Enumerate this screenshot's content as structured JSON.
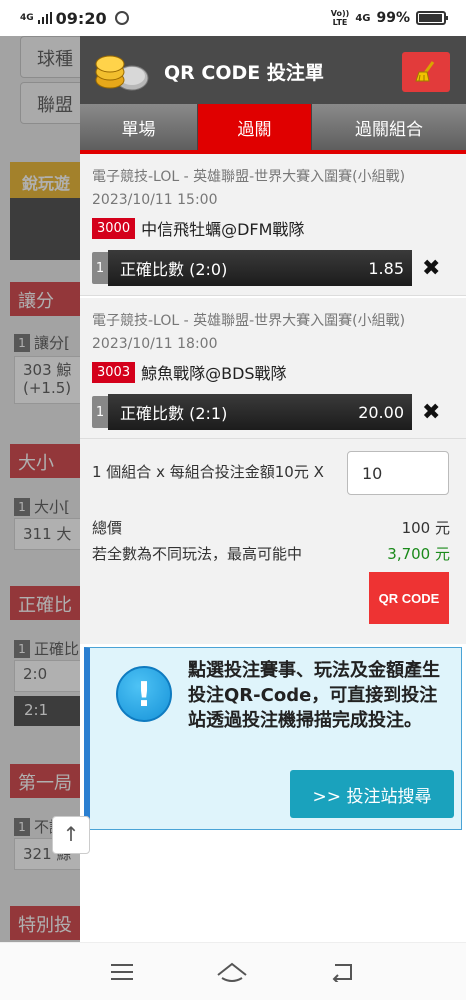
{
  "status_bar": {
    "signal": "4G",
    "time": "09:20",
    "network_top": "Vo))",
    "network_mid": "LTE",
    "network_4g": "4G",
    "battery": "99%"
  },
  "background": {
    "buttons": [
      "球種",
      "聯盟"
    ],
    "gold_tab": "銳玩遊",
    "section_1": "讓分",
    "row_1": "讓分[",
    "card_1_line1": "303 鯨",
    "card_1_line2": "(+1.5)",
    "section_2": "大小",
    "row_2": "大小[",
    "card_2": "311 大",
    "section_3": "正確比",
    "row_3": "正確比",
    "opt_1": "2:0",
    "opt_2": "2:1",
    "section_4": "第一局",
    "row_4": "不讓分",
    "card_4": "321 鯨",
    "section_5": "特別投"
  },
  "panel": {
    "title": "QR CODE 投注單",
    "tabs": [
      {
        "label": "單場"
      },
      {
        "label": "過關"
      },
      {
        "label": "過關組合"
      }
    ],
    "bets": [
      {
        "league": "電子競技-LOL - 英雄聯盟-世界大賽入圍賽(小組戰)",
        "date": "2023/10/11 15:00",
        "code": "3000",
        "teams": "中信飛牡蠣@DFM戰隊",
        "num": "1",
        "selection": "正確比數 (2:0)",
        "odds": "1.85"
      },
      {
        "league": "電子競技-LOL - 英雄聯盟-世界大賽入圍賽(小組戰)",
        "date": "2023/10/11 18:00",
        "code": "3003",
        "teams": "鯨魚戰隊@BDS戰隊",
        "num": "1",
        "selection": "正確比數 (2:1)",
        "odds": "20.00"
      }
    ],
    "combo_text": "1 個組合 x 每組合投注金額10元 X",
    "amount_value": "10",
    "total_label": "總價",
    "total_value": "100 元",
    "max_label": "若全數為不同玩法，最高可能中",
    "max_value": "3,700 元",
    "qr_button": "QR CODE",
    "info_text": "點選投注賽事、玩法及金額產生投注QR-Code，可直接到投注站透過投注機掃描完成投注。",
    "station_button": ">> 投注站搜尋"
  },
  "scroll_top": "↑",
  "colors": {
    "accent_red": "#e00000",
    "header_gray": "#4a4a4a",
    "info_blue": "#2b7fd1",
    "station_teal": "#1aa2bd",
    "win_green": "#1a8a1a"
  }
}
